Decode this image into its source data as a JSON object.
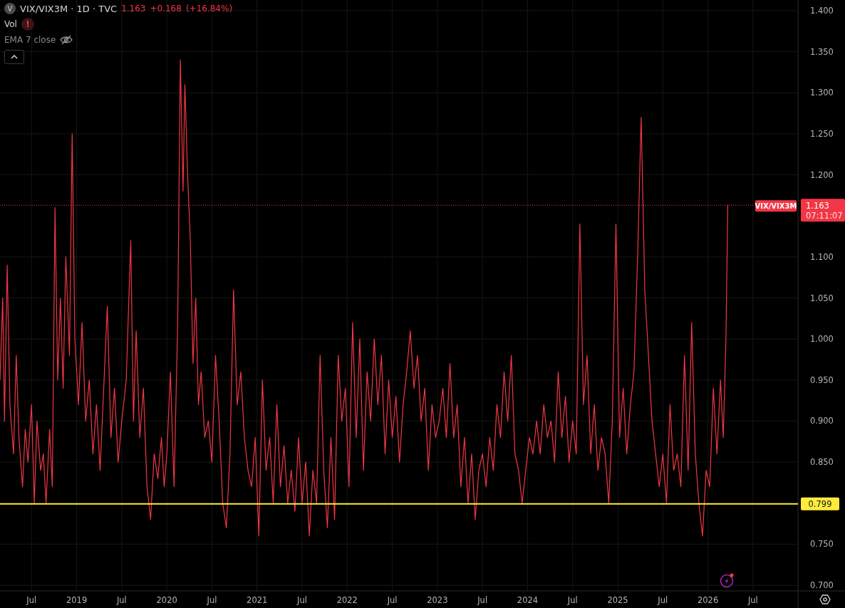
{
  "legend": {
    "badge": "V",
    "title": "VIX/VIX3M · 1D · TVC",
    "price": "1.163",
    "change": "+0.168",
    "change_pct": "(+16.84%)",
    "indicators": [
      {
        "kind": "volume",
        "label": "Vol",
        "warning": "!",
        "hidden": false
      },
      {
        "kind": "ema",
        "label": "EMA 7 close",
        "hidden": true
      }
    ],
    "collapsed": false
  },
  "chart_data": {
    "type": "line",
    "x": [
      2018.15,
      2018.18,
      2018.2,
      2018.23,
      2018.26,
      2018.3,
      2018.33,
      2018.36,
      2018.4,
      2018.43,
      2018.46,
      2018.5,
      2018.53,
      2018.56,
      2018.6,
      2018.63,
      2018.66,
      2018.7,
      2018.73,
      2018.76,
      2018.79,
      2018.82,
      2018.85,
      2018.88,
      2018.92,
      2018.95,
      2018.98,
      2019.02,
      2019.06,
      2019.1,
      2019.14,
      2019.18,
      2019.22,
      2019.26,
      2019.3,
      2019.34,
      2019.38,
      2019.42,
      2019.46,
      2019.5,
      2019.55,
      2019.6,
      2019.63,
      2019.66,
      2019.7,
      2019.74,
      2019.78,
      2019.82,
      2019.86,
      2019.9,
      2019.94,
      2019.97,
      2020.0,
      2020.04,
      2020.08,
      2020.12,
      2020.15,
      2020.18,
      2020.2,
      2020.23,
      2020.26,
      2020.29,
      2020.32,
      2020.35,
      2020.38,
      2020.42,
      2020.46,
      2020.5,
      2020.54,
      2020.58,
      2020.62,
      2020.66,
      2020.7,
      2020.74,
      2020.78,
      2020.82,
      2020.86,
      2020.9,
      2020.94,
      2020.98,
      2021.02,
      2021.06,
      2021.1,
      2021.14,
      2021.18,
      2021.22,
      2021.26,
      2021.3,
      2021.34,
      2021.38,
      2021.42,
      2021.46,
      2021.5,
      2021.54,
      2021.58,
      2021.62,
      2021.66,
      2021.7,
      2021.74,
      2021.78,
      2021.82,
      2021.86,
      2021.9,
      2021.94,
      2021.98,
      2022.02,
      2022.06,
      2022.1,
      2022.14,
      2022.18,
      2022.22,
      2022.26,
      2022.3,
      2022.34,
      2022.38,
      2022.42,
      2022.46,
      2022.5,
      2022.54,
      2022.58,
      2022.62,
      2022.66,
      2022.7,
      2022.74,
      2022.78,
      2022.82,
      2022.86,
      2022.9,
      2022.94,
      2022.98,
      2023.02,
      2023.06,
      2023.1,
      2023.14,
      2023.18,
      2023.22,
      2023.26,
      2023.3,
      2023.34,
      2023.38,
      2023.42,
      2023.46,
      2023.5,
      2023.54,
      2023.58,
      2023.62,
      2023.66,
      2023.7,
      2023.74,
      2023.78,
      2023.82,
      2023.86,
      2023.9,
      2023.94,
      2023.98,
      2024.02,
      2024.06,
      2024.1,
      2024.14,
      2024.18,
      2024.22,
      2024.26,
      2024.3,
      2024.34,
      2024.38,
      2024.42,
      2024.46,
      2024.5,
      2024.54,
      2024.58,
      2024.62,
      2024.66,
      2024.7,
      2024.74,
      2024.78,
      2024.82,
      2024.86,
      2024.9,
      2024.94,
      2024.98,
      2025.02,
      2025.06,
      2025.1,
      2025.14,
      2025.18,
      2025.22,
      2025.26,
      2025.3,
      2025.34,
      2025.38,
      2025.42,
      2025.46,
      2025.5,
      2025.54,
      2025.58,
      2025.62,
      2025.66,
      2025.7,
      2025.74,
      2025.78,
      2025.82,
      2025.86,
      2025.9,
      2025.94,
      2025.98,
      2026.02,
      2026.06,
      2026.1,
      2026.14,
      2026.17,
      2026.2,
      2026.22
    ],
    "series": [
      {
        "name": "VIX/VIX3M",
        "color": "#f23645",
        "values": [
          0.95,
          1.05,
          0.9,
          1.09,
          0.92,
          0.86,
          0.98,
          0.88,
          0.82,
          0.89,
          0.85,
          0.92,
          0.8,
          0.9,
          0.84,
          0.86,
          0.8,
          0.89,
          0.82,
          1.16,
          0.95,
          1.05,
          0.94,
          1.1,
          0.98,
          1.25,
          1.0,
          0.92,
          1.02,
          0.9,
          0.95,
          0.86,
          0.92,
          0.84,
          0.94,
          1.04,
          0.88,
          0.94,
          0.85,
          0.9,
          0.95,
          1.12,
          0.9,
          1.01,
          0.88,
          0.94,
          0.82,
          0.78,
          0.86,
          0.83,
          0.88,
          0.82,
          0.86,
          0.96,
          0.82,
          1.02,
          1.34,
          1.18,
          1.31,
          1.2,
          1.12,
          0.97,
          1.05,
          0.92,
          0.96,
          0.88,
          0.9,
          0.85,
          0.98,
          0.9,
          0.8,
          0.77,
          0.86,
          1.06,
          0.92,
          0.96,
          0.88,
          0.84,
          0.82,
          0.88,
          0.76,
          0.95,
          0.84,
          0.88,
          0.8,
          0.92,
          0.82,
          0.87,
          0.8,
          0.84,
          0.79,
          0.88,
          0.8,
          0.85,
          0.76,
          0.84,
          0.8,
          0.98,
          0.84,
          0.77,
          0.88,
          0.78,
          0.98,
          0.9,
          0.94,
          0.82,
          1.02,
          0.88,
          1.0,
          0.84,
          0.96,
          0.9,
          1.0,
          0.92,
          0.98,
          0.86,
          0.95,
          0.88,
          0.93,
          0.85,
          0.92,
          0.96,
          1.01,
          0.94,
          0.98,
          0.9,
          0.94,
          0.84,
          0.92,
          0.88,
          0.9,
          0.94,
          0.88,
          0.97,
          0.88,
          0.92,
          0.82,
          0.88,
          0.8,
          0.86,
          0.78,
          0.84,
          0.86,
          0.82,
          0.88,
          0.84,
          0.92,
          0.88,
          0.96,
          0.9,
          0.98,
          0.86,
          0.84,
          0.8,
          0.84,
          0.88,
          0.86,
          0.9,
          0.86,
          0.92,
          0.88,
          0.9,
          0.85,
          0.96,
          0.88,
          0.93,
          0.85,
          0.9,
          0.86,
          1.14,
          0.92,
          0.98,
          0.86,
          0.92,
          0.84,
          0.88,
          0.86,
          0.8,
          0.9,
          1.14,
          0.88,
          0.94,
          0.86,
          0.92,
          0.96,
          1.1,
          1.27,
          1.06,
          0.98,
          0.9,
          0.86,
          0.82,
          0.86,
          0.8,
          0.92,
          0.84,
          0.86,
          0.82,
          0.98,
          0.84,
          1.02,
          0.86,
          0.8,
          0.76,
          0.84,
          0.82,
          0.94,
          0.86,
          0.95,
          0.88,
          1.0,
          1.163
        ]
      }
    ],
    "xlim": [
      2018.15,
      2027.52
    ],
    "grid": true,
    "ylim": [
      0.7,
      1.4
    ],
    "xticks": [
      {
        "value": 2018.5,
        "label": "Jul"
      },
      {
        "value": 2019,
        "label": "2019"
      },
      {
        "value": 2019.5,
        "label": "Jul"
      },
      {
        "value": 2020,
        "label": "2020"
      },
      {
        "value": 2020.5,
        "label": "Jul"
      },
      {
        "value": 2021,
        "label": "2021"
      },
      {
        "value": 2021.5,
        "label": "Jul"
      },
      {
        "value": 2022,
        "label": "2022"
      },
      {
        "value": 2022.5,
        "label": "Jul"
      },
      {
        "value": 2023,
        "label": "2023"
      },
      {
        "value": 2023.5,
        "label": "Jul"
      },
      {
        "value": 2024,
        "label": "2024"
      },
      {
        "value": 2024.5,
        "label": "Jul"
      },
      {
        "value": 2025,
        "label": "2025"
      },
      {
        "value": 2025.5,
        "label": "Jul"
      },
      {
        "value": 2026,
        "label": "2026"
      },
      {
        "value": 2026.5,
        "label": "Jul"
      }
    ],
    "yticks": [
      {
        "value": 0.7,
        "label": "0.700"
      },
      {
        "value": 0.75,
        "label": "0.750"
      },
      {
        "value": 0.85,
        "label": "0.850"
      },
      {
        "value": 0.9,
        "label": "0.900"
      },
      {
        "value": 0.95,
        "label": "0.950"
      },
      {
        "value": 1.0,
        "label": "1.000"
      },
      {
        "value": 1.05,
        "label": "1.050"
      },
      {
        "value": 1.1,
        "label": "1.100"
      },
      {
        "value": 1.2,
        "label": "1.200"
      },
      {
        "value": 1.25,
        "label": "1.250"
      },
      {
        "value": 1.3,
        "label": "1.300"
      },
      {
        "value": 1.35,
        "label": "1.350"
      },
      {
        "value": 1.4,
        "label": "1.400"
      }
    ],
    "ref_lines": [
      {
        "axis": "y",
        "value": 0.799,
        "label": "0.799",
        "color": "#ffeb3b"
      },
      {
        "axis": "y",
        "value": 1.163,
        "color": "#f23645"
      }
    ]
  },
  "price_tag": {
    "value": "1.163",
    "countdown": "07:11:07"
  },
  "alerts": {
    "unread": true
  }
}
